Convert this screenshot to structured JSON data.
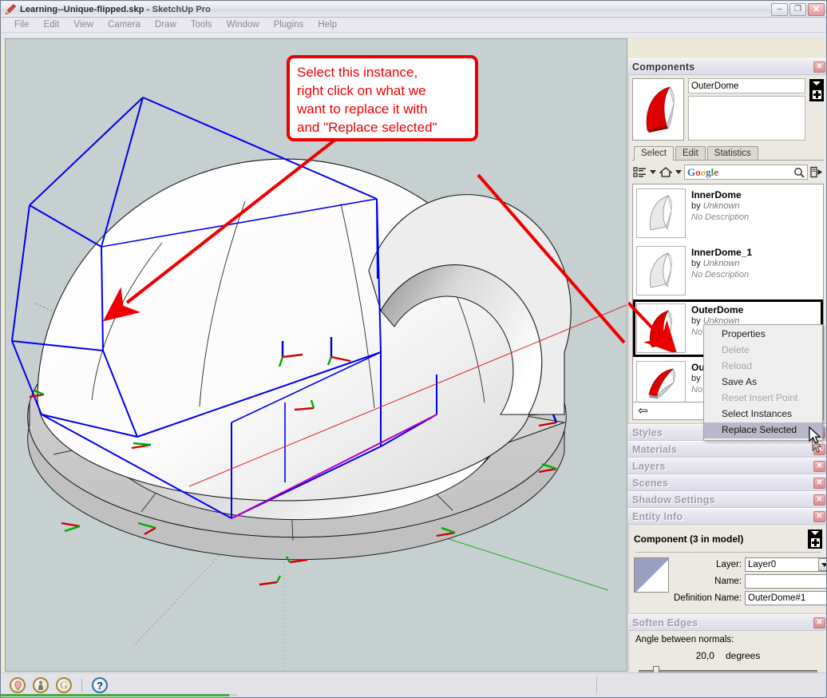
{
  "window": {
    "title_document": "Learning--Unique-flipped.skp",
    "title_separator": " - ",
    "title_app": "SketchUp Pro",
    "app_icon": "sketchup-pencil-icon",
    "minimize_label": "–",
    "maximize_label": "❐",
    "close_label": "✕"
  },
  "menubar": {
    "items": [
      {
        "label": "File"
      },
      {
        "label": "Edit"
      },
      {
        "label": "View"
      },
      {
        "label": "Camera"
      },
      {
        "label": "Draw"
      },
      {
        "label": "Tools"
      },
      {
        "label": "Window"
      },
      {
        "label": "Plugins"
      },
      {
        "label": "Help"
      }
    ]
  },
  "annotation": {
    "text": "Select this instance,\nright click on what we\nwant to replace it with\nand \"Replace selected\"",
    "color": "#ee0000"
  },
  "components_panel": {
    "title": "Components",
    "close_label": "✕",
    "preview_icon": "outerdome-red-thumbnail",
    "name_value": "OuterDome",
    "description_value": "",
    "stack_button": "component-stack-button",
    "tabs": [
      {
        "label": "Select",
        "selected": true
      },
      {
        "label": "Edit",
        "selected": false
      },
      {
        "label": "Statistics",
        "selected": false
      }
    ],
    "search": {
      "placeholder": "Google",
      "google_letters": [
        "G",
        "o",
        "o",
        "g",
        "l",
        "e"
      ],
      "view_options_icon": "list-view-icon",
      "home_icon": "home-icon",
      "search_icon": "magnifier-icon",
      "details_icon": "details-flyout-icon"
    },
    "list": [
      {
        "name": "InnerDome",
        "by": "by ",
        "author": "Unknown",
        "description": "No Description",
        "thumb": "innerdome-white-thumbnail",
        "selected": false
      },
      {
        "name": "InnerDome_1",
        "by": "by ",
        "author": "Unknown",
        "description": "No Description",
        "thumb": "innerdome-white-thumbnail",
        "selected": false
      },
      {
        "name": "OuterDome",
        "by": "by ",
        "author": "Unknown",
        "description": "No Description",
        "thumb": "outerdome-red-thumbnail",
        "selected": true
      },
      {
        "name": "Ou",
        "by": "by ",
        "author": "",
        "description": "No",
        "thumb": "outerdome-red-thumbnail",
        "selected": false
      }
    ],
    "footer_back_icon": "back-arrow-icon"
  },
  "context_menu": {
    "items": [
      {
        "label": "Properties",
        "disabled": false,
        "highlighted": false
      },
      {
        "label": "Delete",
        "disabled": true,
        "highlighted": false
      },
      {
        "label": "Reload",
        "disabled": true,
        "highlighted": false
      },
      {
        "label": "Save As",
        "disabled": false,
        "highlighted": false
      },
      {
        "label": "Reset Insert Point",
        "disabled": true,
        "highlighted": false
      },
      {
        "label": "Select Instances",
        "disabled": false,
        "highlighted": false
      },
      {
        "label": "Replace Selected",
        "disabled": false,
        "highlighted": true
      }
    ]
  },
  "trays": [
    {
      "title": "Styles",
      "close_label": "✕",
      "active": false
    },
    {
      "title": "Materials",
      "close_label": "✕",
      "active": false
    },
    {
      "title": "Layers",
      "close_label": "✕",
      "active": false
    },
    {
      "title": "Scenes",
      "close_label": "✕",
      "active": false
    },
    {
      "title": "Shadow Settings",
      "close_label": "✕",
      "active": false
    },
    {
      "title": "Entity Info",
      "close_label": "✕",
      "active": false
    }
  ],
  "entity_info": {
    "title": "Component (3 in model)",
    "stack_button": "entity-stack-button",
    "swatch_icon": "material-swatch",
    "layer_label": "Layer:",
    "layer_value": "Layer0",
    "name_label": "Name:",
    "name_value": "",
    "definition_label": "Definition Name:",
    "definition_value": "OuterDome#1"
  },
  "soften_edges": {
    "title": "Soften Edges",
    "close_label": "✕",
    "angle_label": "Angle between normals:",
    "angle_value": "20,0",
    "angle_unit": "degrees",
    "slider_percent": 12
  },
  "statusbar": {
    "buttons": [
      {
        "icon": "geo-location-icon"
      },
      {
        "icon": "person-icon"
      },
      {
        "icon": "google-g-icon"
      },
      {
        "icon": "help-question-icon"
      }
    ],
    "measurement_value": ""
  },
  "viewport": {
    "background_color": "#c6d0d0",
    "selection_color": "#0000ee",
    "axis_red": "#cc0000",
    "axis_green": "#00aa00",
    "axis_blue": "#0000cc",
    "model_description": "Dome assembly: outer dome shell, inner dome, annular ring base with radial segments, selected component bounding box shown in blue"
  }
}
